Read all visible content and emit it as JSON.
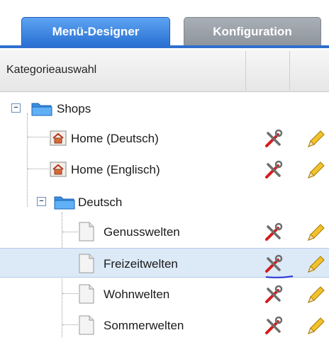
{
  "tabs": [
    {
      "label": "Menü-Designer",
      "active": true
    },
    {
      "label": "Konfiguration",
      "active": false
    }
  ],
  "column_header": {
    "label": "Kategorieauswahl"
  },
  "tree": {
    "root": {
      "label": "Shops",
      "icon": "folder-icon",
      "expanded": true
    },
    "home_items": [
      {
        "label": "Home (Deutsch)",
        "icon": "home-page-icon"
      },
      {
        "label": "Home (Englisch)",
        "icon": "home-page-icon"
      }
    ],
    "folder": {
      "label": "Deutsch",
      "icon": "folder-icon",
      "expanded": true
    },
    "pages": [
      {
        "label": "Genusswelten",
        "selected": false
      },
      {
        "label": "Freizeitwelten",
        "selected": true
      },
      {
        "label": "Wohnwelten",
        "selected": false
      },
      {
        "label": "Sommerwelten",
        "selected": false
      }
    ]
  },
  "row_actions": [
    "wrench-screwdriver-icon",
    "pencil-icon"
  ],
  "colors": {
    "accent": "#2f6fcf",
    "selected_row": "#dce9f7"
  }
}
